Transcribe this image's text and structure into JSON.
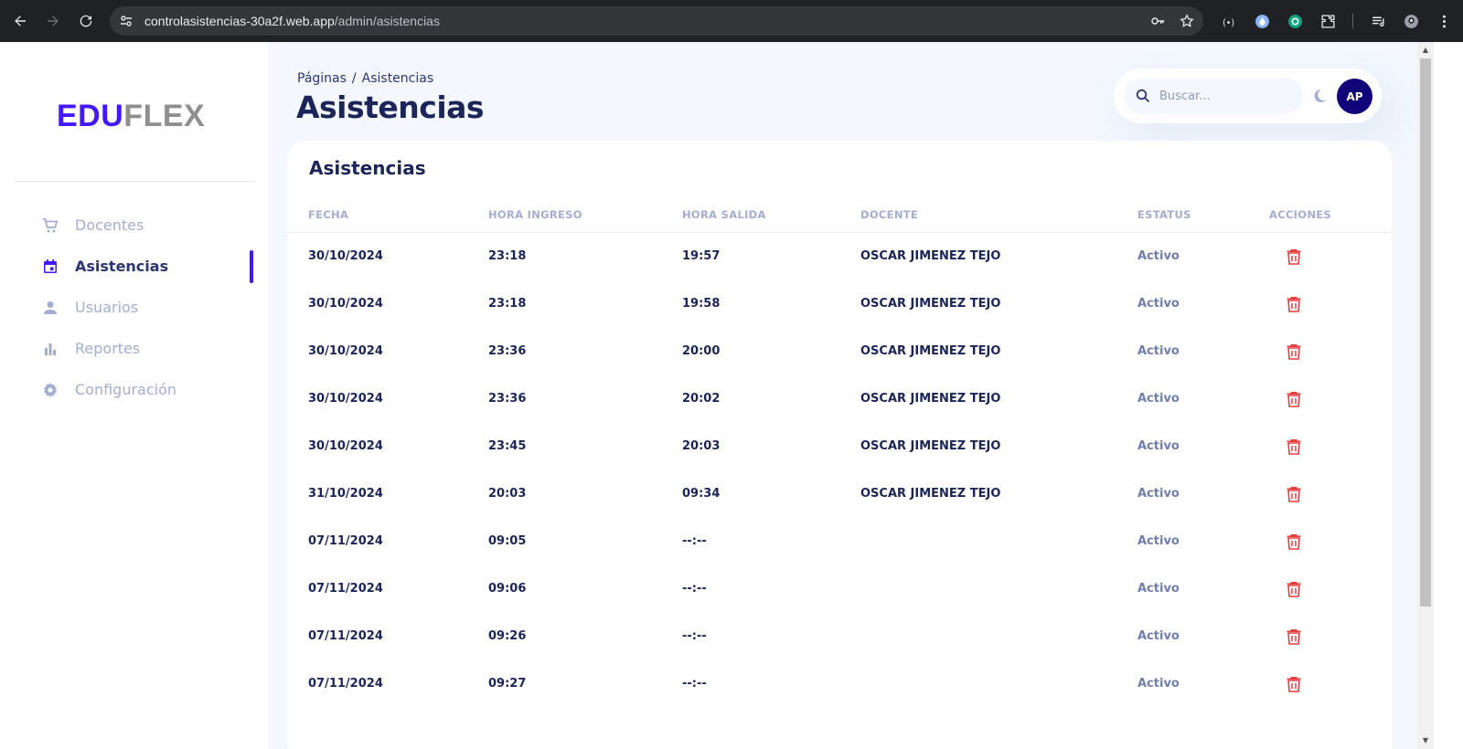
{
  "browser": {
    "url_host": "controlasistencias-30a2f.web.app",
    "url_path": "/admin/asistencias"
  },
  "sidebar": {
    "logo_primary": "EDU",
    "logo_secondary": "FLEX",
    "items": [
      {
        "label": "Docentes",
        "icon": "cart-icon"
      },
      {
        "label": "Asistencias",
        "icon": "calendar-icon",
        "active": true
      },
      {
        "label": "Usuarios",
        "icon": "person-icon"
      },
      {
        "label": "Reportes",
        "icon": "bar-chart-icon"
      },
      {
        "label": "Configuración",
        "icon": "gear-icon"
      }
    ]
  },
  "header": {
    "breadcrumb_root": "Páginas",
    "breadcrumb_separator": "/",
    "breadcrumb_current": "Asistencias",
    "title": "Asistencias"
  },
  "topbar": {
    "search_placeholder": "Buscar...",
    "avatar_initials": "AP"
  },
  "table": {
    "title": "Asistencias",
    "columns": [
      "FECHA",
      "HORA INGRESO",
      "HORA SALIDA",
      "DOCENTE",
      "ESTATUS",
      "ACCIONES"
    ],
    "rows": [
      {
        "fecha": "30/10/2024",
        "ingreso": "23:18",
        "salida": "19:57",
        "docente": "OSCAR JIMENEZ TEJO",
        "estatus": "Activo"
      },
      {
        "fecha": "30/10/2024",
        "ingreso": "23:18",
        "salida": "19:58",
        "docente": "OSCAR JIMENEZ TEJO",
        "estatus": "Activo"
      },
      {
        "fecha": "30/10/2024",
        "ingreso": "23:36",
        "salida": "20:00",
        "docente": "OSCAR JIMENEZ TEJO",
        "estatus": "Activo"
      },
      {
        "fecha": "30/10/2024",
        "ingreso": "23:36",
        "salida": "20:02",
        "docente": "OSCAR JIMENEZ TEJO",
        "estatus": "Activo"
      },
      {
        "fecha": "30/10/2024",
        "ingreso": "23:45",
        "salida": "20:03",
        "docente": "OSCAR JIMENEZ TEJO",
        "estatus": "Activo"
      },
      {
        "fecha": "31/10/2024",
        "ingreso": "20:03",
        "salida": "09:34",
        "docente": "OSCAR JIMENEZ TEJO",
        "estatus": "Activo"
      },
      {
        "fecha": "07/11/2024",
        "ingreso": "09:05",
        "salida": "--:--",
        "docente": "",
        "estatus": "Activo"
      },
      {
        "fecha": "07/11/2024",
        "ingreso": "09:06",
        "salida": "--:--",
        "docente": "",
        "estatus": "Activo"
      },
      {
        "fecha": "07/11/2024",
        "ingreso": "09:26",
        "salida": "--:--",
        "docente": "",
        "estatus": "Activo"
      },
      {
        "fecha": "07/11/2024",
        "ingreso": "09:27",
        "salida": "--:--",
        "docente": "",
        "estatus": "Activo"
      }
    ]
  },
  "colors": {
    "brand": "#4318ff",
    "navy": "#1b2559",
    "muted": "#a3aed0",
    "delete": "#e53e3e",
    "background": "#f4f7fe"
  }
}
